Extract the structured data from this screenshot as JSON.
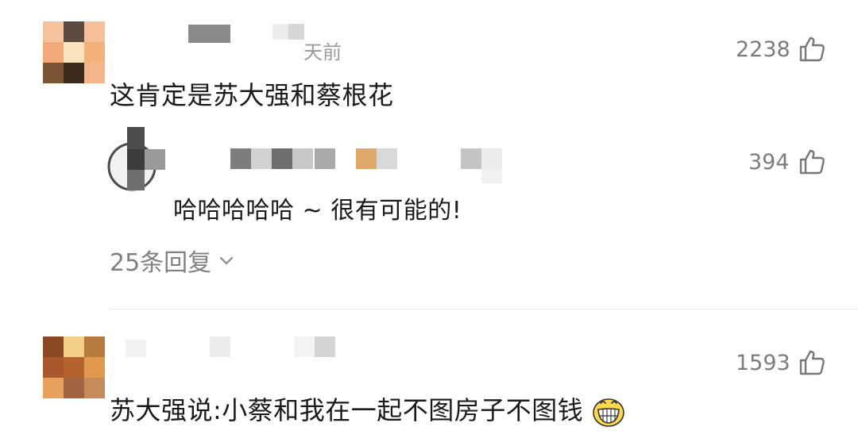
{
  "comments": [
    {
      "time": "天前",
      "text": "这肯定是苏大强和蔡根花",
      "likes": "2238",
      "avatar_colors": [
        "#f6c29e",
        "#5e4b3f",
        "#f7bf9c",
        "#f4a97b",
        "#f9e3bd",
        "#f3b079",
        "#7c5634",
        "#3d2b1d",
        "#f4b58d"
      ]
    },
    {
      "text": "苏大强说:小蔡和我在一起不图房子不图钱",
      "likes": "1593",
      "emoji_icon": "grinning-face-icon",
      "avatar_colors": [
        "#8c4a24",
        "#f3cf85",
        "#b67a3f",
        "#a9582d",
        "#b5632e",
        "#e09a4f",
        "#e7a15c",
        "#a36444",
        "#c58b5a"
      ]
    }
  ],
  "reply": {
    "text": "哈哈哈哈哈 ~ 很有可能的!",
    "likes": "394"
  },
  "more_replies": {
    "label": "25条回复"
  }
}
